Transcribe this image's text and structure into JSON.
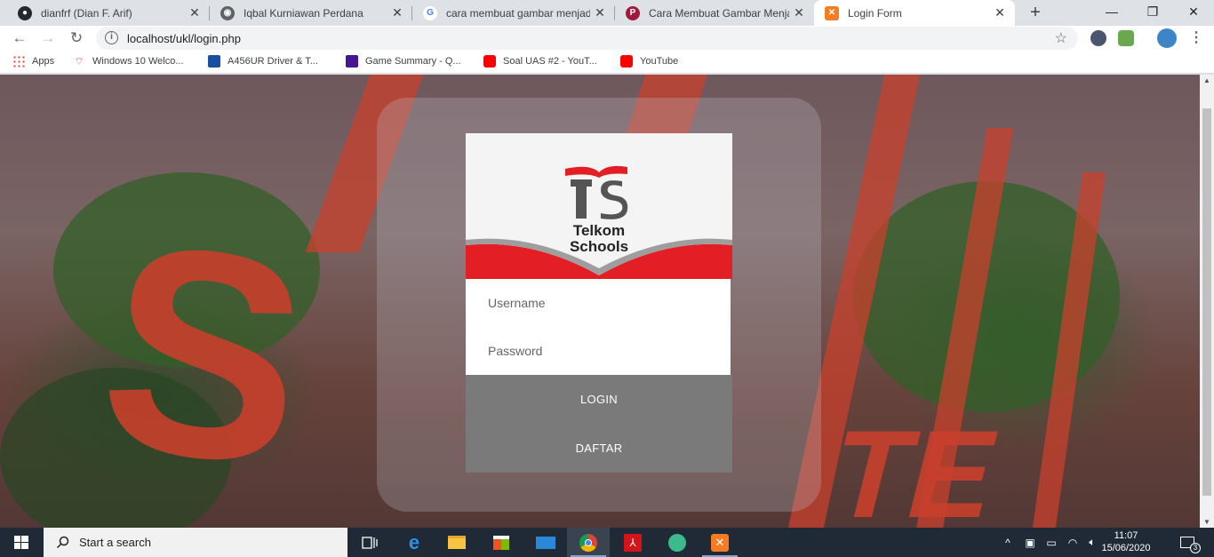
{
  "browser": {
    "tabs": [
      {
        "title": "dianfrf (Dian F. Arif)",
        "icon": "github-icon",
        "active": false
      },
      {
        "title": "Iqbal Kurniawan Perdana",
        "icon": "globe-icon",
        "active": false
      },
      {
        "title": "cara membuat gambar menjadi",
        "icon": "google-icon",
        "active": false
      },
      {
        "title": "Cara Membuat Gambar Menjadi",
        "icon": "p-site-icon",
        "active": false
      },
      {
        "title": "Login Form",
        "icon": "xampp-icon",
        "active": true
      }
    ],
    "url": "localhost/ukl/login.php",
    "bookmarks": [
      {
        "label": "Apps",
        "icon": "apps-grid-icon"
      },
      {
        "label": "Windows 10 Welco...",
        "icon": "wifi-icon"
      },
      {
        "label": "A456UR Driver & T...",
        "icon": "asus-icon"
      },
      {
        "label": "Game Summary - Q...",
        "icon": "game-icon"
      },
      {
        "label": "Soal UAS #2 - YouT...",
        "icon": "youtube-icon"
      },
      {
        "label": "YouTube",
        "icon": "youtube-icon"
      }
    ]
  },
  "login": {
    "logo_line1": "Telkom",
    "logo_line2": "Schools",
    "username_placeholder": "Username",
    "password_placeholder": "Password",
    "login_label": "LOGIN",
    "register_label": "DAFTAR"
  },
  "taskbar": {
    "search_placeholder": "Start a search",
    "time": "11:07",
    "date": "15/06/2020",
    "notification_count": "3"
  },
  "colors": {
    "brand_red": "#e31e24",
    "button_gray": "#7a7a7a",
    "taskbar": "#1f2a36"
  }
}
